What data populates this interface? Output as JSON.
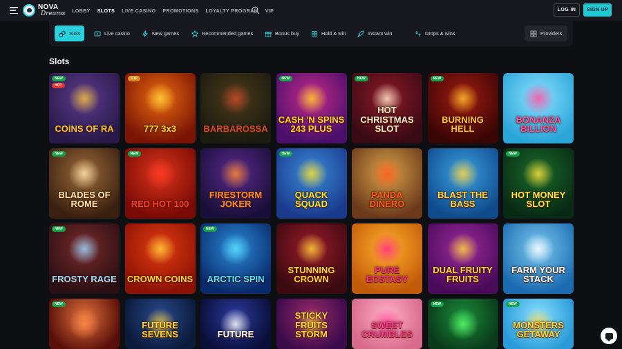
{
  "brand": {
    "line1": "NOVA",
    "line2": "Dreams"
  },
  "nav": [
    {
      "label": "LOBBY",
      "active": false
    },
    {
      "label": "SLOTS",
      "active": true
    },
    {
      "label": "LIVE CASINO",
      "active": false
    },
    {
      "label": "PROMOTIONS",
      "active": false
    },
    {
      "label": "LOYALTY PROGRAM",
      "active": false
    },
    {
      "label": "VIP",
      "active": false
    }
  ],
  "auth": {
    "login": "LOG IN",
    "signup": "SIGN UP"
  },
  "categories": [
    {
      "label": "Slots",
      "icon": "slots-icon",
      "active": true
    },
    {
      "label": "Live casino",
      "icon": "tv-icon",
      "active": false
    },
    {
      "label": "New games",
      "icon": "lightning-icon",
      "active": false
    },
    {
      "label": "Recommended games",
      "icon": "star-icon",
      "active": false
    },
    {
      "label": "Bonus buy",
      "icon": "gift-icon",
      "active": false
    },
    {
      "label": "Hold & win",
      "icon": "hold-win-icon",
      "active": false
    },
    {
      "label": "Instant win",
      "icon": "rocket-icon",
      "active": false
    },
    {
      "label": "Drops & wins",
      "icon": "drops-icon",
      "active": false
    }
  ],
  "providers_label": "Providers",
  "section_title": "Slots",
  "games": [
    {
      "title": "COINS OF RA",
      "tag": "NEW",
      "badge": "HOT",
      "bg1": "#2a1a4a",
      "bg2": "#5b3a8c",
      "accent": "#f3c23a"
    },
    {
      "title": "777 3x3",
      "tag": "TOP",
      "badge": "",
      "bg1": "#7a1405",
      "bg2": "#e86a10",
      "accent": "#ffd23a"
    },
    {
      "title": "BARBAROSSA",
      "tag": "",
      "badge": "",
      "bg1": "#1b1b10",
      "bg2": "#4b3a1a",
      "accent": "#c94a2a"
    },
    {
      "title": "CASH 'N SPINS 243 PLUS",
      "tag": "NEW",
      "badge": "",
      "bg1": "#4a0f6b",
      "bg2": "#c42a8a",
      "accent": "#ffd02a"
    },
    {
      "title": "HOT CHRISTMAS SLOT",
      "tag": "NEW",
      "badge": "",
      "bg1": "#3a0a14",
      "bg2": "#8c1a28",
      "accent": "#ffe9c8"
    },
    {
      "title": "BURNING HELL",
      "tag": "NEW",
      "badge": "",
      "bg1": "#3a0505",
      "bg2": "#a31b12",
      "accent": "#ffbf2a"
    },
    {
      "title": "BONANZA BILLION",
      "tag": "",
      "badge": "",
      "bg1": "#2aa5d8",
      "bg2": "#8be0ff",
      "accent": "#ff4fa2"
    },
    {
      "title": "BLADES OF ROME",
      "tag": "NEW",
      "badge": "",
      "bg1": "#3a2010",
      "bg2": "#9b6a3a",
      "accent": "#ffe3a8"
    },
    {
      "title": "RED HOT 100",
      "tag": "NEW",
      "badge": "",
      "bg1": "#7a0a05",
      "bg2": "#d8341a",
      "accent": "#ff3a24"
    },
    {
      "title": "FIRESTORM JOKER",
      "tag": "",
      "badge": "",
      "bg1": "#1a0f3a",
      "bg2": "#5a2a8c",
      "accent": "#ff8a2a"
    },
    {
      "title": "QUACK SQUAD",
      "tag": "NEW",
      "badge": "",
      "bg1": "#1a3a8c",
      "bg2": "#3a8ad8",
      "accent": "#ffe02a"
    },
    {
      "title": "PANDA DINERO",
      "tag": "",
      "badge": "",
      "bg1": "#6b3a1a",
      "bg2": "#d8a04a",
      "accent": "#ff5a1a"
    },
    {
      "title": "BLAST THE BASS",
      "tag": "",
      "badge": "",
      "bg1": "#0f4a8c",
      "bg2": "#3aa0e0",
      "accent": "#ffd23a"
    },
    {
      "title": "HOT MONEY SLOT",
      "tag": "NEW",
      "badge": "",
      "bg1": "#082a14",
      "bg2": "#1a6a2a",
      "accent": "#ffe23a"
    },
    {
      "title": "FROSTY RAGE",
      "tag": "NEW",
      "badge": "",
      "bg1": "#2a0f14",
      "bg2": "#7a2a2a",
      "accent": "#9ad8ff"
    },
    {
      "title": "CROWN COINS",
      "tag": "",
      "badge": "",
      "bg1": "#8c1205",
      "bg2": "#e03a10",
      "accent": "#ffd03a"
    },
    {
      "title": "ARCTIC SPIN",
      "tag": "NEW",
      "badge": "",
      "bg1": "#0a2a6b",
      "bg2": "#2a8ad8",
      "accent": "#5ae0ff"
    },
    {
      "title": "STUNNING CROWN",
      "tag": "",
      "badge": "",
      "bg1": "#3a0a10",
      "bg2": "#9b1a2a",
      "accent": "#ffd23a"
    },
    {
      "title": "PURE ECSTASY",
      "tag": "",
      "badge": "",
      "bg1": "#c25a0a",
      "bg2": "#ffb02a",
      "accent": "#ff2a8a"
    },
    {
      "title": "DUAL FRUITY FRUITS",
      "tag": "",
      "badge": "",
      "bg1": "#4a0a5a",
      "bg2": "#9b2a9b",
      "accent": "#ffd23a"
    },
    {
      "title": "FARM YOUR STACK",
      "tag": "",
      "badge": "",
      "bg1": "#1a6bb0",
      "bg2": "#7ac8f0",
      "accent": "#ffffff"
    },
    {
      "title": "",
      "tag": "NEW",
      "badge": "",
      "bg1": "#5a0f0a",
      "bg2": "#e0703a",
      "accent": "#ff8a4a"
    },
    {
      "title": "FUTURE SEVENS",
      "tag": "",
      "badge": "",
      "bg1": "#0a1a3a",
      "bg2": "#2a4a8c",
      "accent": "#ffd23a"
    },
    {
      "title": "FUTURE",
      "tag": "",
      "badge": "",
      "bg1": "#0a0f3a",
      "bg2": "#2a3a9b",
      "accent": "#ffffff"
    },
    {
      "title": "STICKY FRUITS STORM",
      "tag": "",
      "badge": "",
      "bg1": "#3a0a4a",
      "bg2": "#9b2a6b",
      "accent": "#ffd23a"
    },
    {
      "title": "SWEET CRUMBLES",
      "tag": "",
      "badge": "",
      "bg1": "#d86a8c",
      "bg2": "#ffb0c8",
      "accent": "#ff3a8a"
    },
    {
      "title": "",
      "tag": "NEW",
      "badge": "",
      "bg1": "#0a3a1a",
      "bg2": "#1a8c3a",
      "accent": "#5aff6a"
    },
    {
      "title": "MONSTERS GETAWAY",
      "tag": "NEW",
      "badge": "",
      "bg1": "#2a9bd8",
      "bg2": "#8ae0ff",
      "accent": "#ffd23a"
    }
  ]
}
